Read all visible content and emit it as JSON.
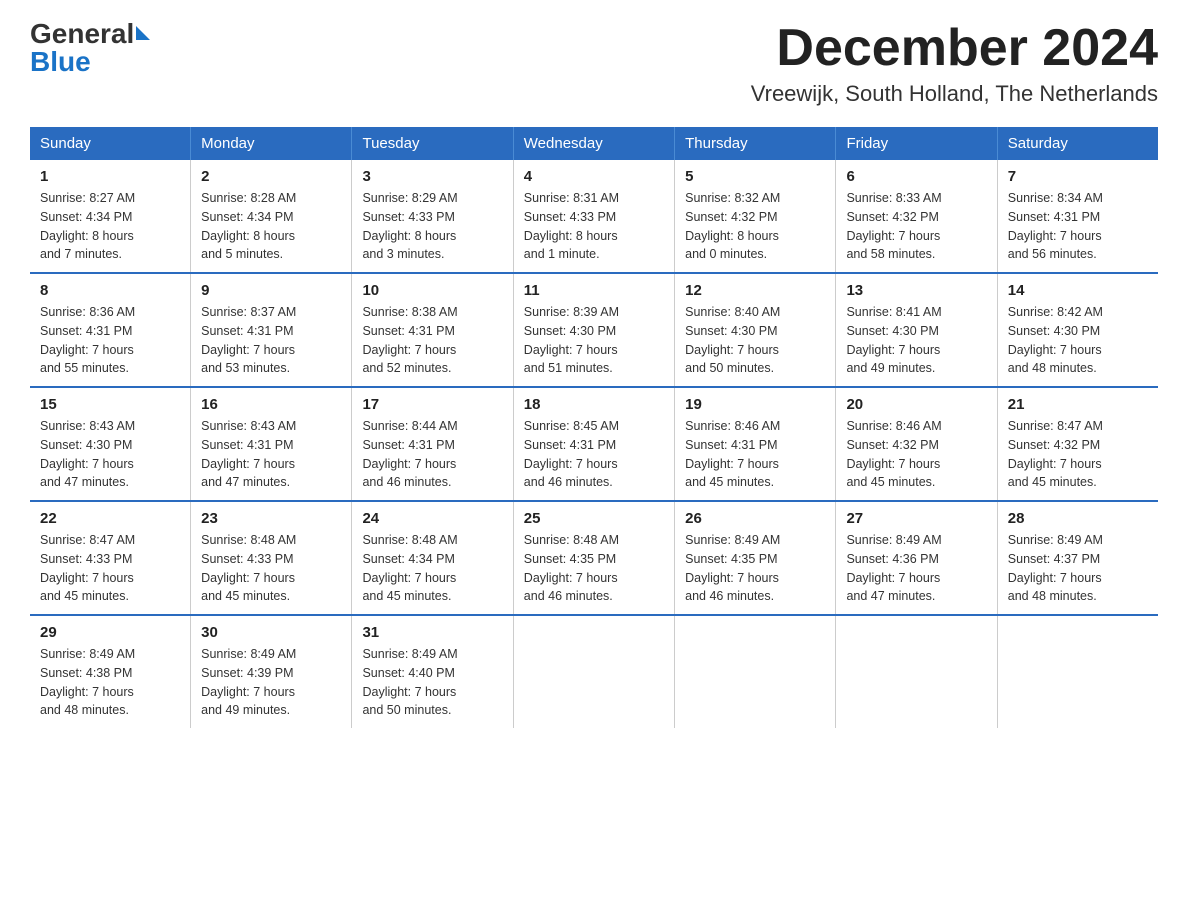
{
  "logo": {
    "text_general": "General",
    "text_blue": "Blue"
  },
  "title": "December 2024",
  "subtitle": "Vreewijk, South Holland, The Netherlands",
  "weekdays": [
    "Sunday",
    "Monday",
    "Tuesday",
    "Wednesday",
    "Thursday",
    "Friday",
    "Saturday"
  ],
  "weeks": [
    [
      {
        "day": "1",
        "info": "Sunrise: 8:27 AM\nSunset: 4:34 PM\nDaylight: 8 hours\nand 7 minutes."
      },
      {
        "day": "2",
        "info": "Sunrise: 8:28 AM\nSunset: 4:34 PM\nDaylight: 8 hours\nand 5 minutes."
      },
      {
        "day": "3",
        "info": "Sunrise: 8:29 AM\nSunset: 4:33 PM\nDaylight: 8 hours\nand 3 minutes."
      },
      {
        "day": "4",
        "info": "Sunrise: 8:31 AM\nSunset: 4:33 PM\nDaylight: 8 hours\nand 1 minute."
      },
      {
        "day": "5",
        "info": "Sunrise: 8:32 AM\nSunset: 4:32 PM\nDaylight: 8 hours\nand 0 minutes."
      },
      {
        "day": "6",
        "info": "Sunrise: 8:33 AM\nSunset: 4:32 PM\nDaylight: 7 hours\nand 58 minutes."
      },
      {
        "day": "7",
        "info": "Sunrise: 8:34 AM\nSunset: 4:31 PM\nDaylight: 7 hours\nand 56 minutes."
      }
    ],
    [
      {
        "day": "8",
        "info": "Sunrise: 8:36 AM\nSunset: 4:31 PM\nDaylight: 7 hours\nand 55 minutes."
      },
      {
        "day": "9",
        "info": "Sunrise: 8:37 AM\nSunset: 4:31 PM\nDaylight: 7 hours\nand 53 minutes."
      },
      {
        "day": "10",
        "info": "Sunrise: 8:38 AM\nSunset: 4:31 PM\nDaylight: 7 hours\nand 52 minutes."
      },
      {
        "day": "11",
        "info": "Sunrise: 8:39 AM\nSunset: 4:30 PM\nDaylight: 7 hours\nand 51 minutes."
      },
      {
        "day": "12",
        "info": "Sunrise: 8:40 AM\nSunset: 4:30 PM\nDaylight: 7 hours\nand 50 minutes."
      },
      {
        "day": "13",
        "info": "Sunrise: 8:41 AM\nSunset: 4:30 PM\nDaylight: 7 hours\nand 49 minutes."
      },
      {
        "day": "14",
        "info": "Sunrise: 8:42 AM\nSunset: 4:30 PM\nDaylight: 7 hours\nand 48 minutes."
      }
    ],
    [
      {
        "day": "15",
        "info": "Sunrise: 8:43 AM\nSunset: 4:30 PM\nDaylight: 7 hours\nand 47 minutes."
      },
      {
        "day": "16",
        "info": "Sunrise: 8:43 AM\nSunset: 4:31 PM\nDaylight: 7 hours\nand 47 minutes."
      },
      {
        "day": "17",
        "info": "Sunrise: 8:44 AM\nSunset: 4:31 PM\nDaylight: 7 hours\nand 46 minutes."
      },
      {
        "day": "18",
        "info": "Sunrise: 8:45 AM\nSunset: 4:31 PM\nDaylight: 7 hours\nand 46 minutes."
      },
      {
        "day": "19",
        "info": "Sunrise: 8:46 AM\nSunset: 4:31 PM\nDaylight: 7 hours\nand 45 minutes."
      },
      {
        "day": "20",
        "info": "Sunrise: 8:46 AM\nSunset: 4:32 PM\nDaylight: 7 hours\nand 45 minutes."
      },
      {
        "day": "21",
        "info": "Sunrise: 8:47 AM\nSunset: 4:32 PM\nDaylight: 7 hours\nand 45 minutes."
      }
    ],
    [
      {
        "day": "22",
        "info": "Sunrise: 8:47 AM\nSunset: 4:33 PM\nDaylight: 7 hours\nand 45 minutes."
      },
      {
        "day": "23",
        "info": "Sunrise: 8:48 AM\nSunset: 4:33 PM\nDaylight: 7 hours\nand 45 minutes."
      },
      {
        "day": "24",
        "info": "Sunrise: 8:48 AM\nSunset: 4:34 PM\nDaylight: 7 hours\nand 45 minutes."
      },
      {
        "day": "25",
        "info": "Sunrise: 8:48 AM\nSunset: 4:35 PM\nDaylight: 7 hours\nand 46 minutes."
      },
      {
        "day": "26",
        "info": "Sunrise: 8:49 AM\nSunset: 4:35 PM\nDaylight: 7 hours\nand 46 minutes."
      },
      {
        "day": "27",
        "info": "Sunrise: 8:49 AM\nSunset: 4:36 PM\nDaylight: 7 hours\nand 47 minutes."
      },
      {
        "day": "28",
        "info": "Sunrise: 8:49 AM\nSunset: 4:37 PM\nDaylight: 7 hours\nand 48 minutes."
      }
    ],
    [
      {
        "day": "29",
        "info": "Sunrise: 8:49 AM\nSunset: 4:38 PM\nDaylight: 7 hours\nand 48 minutes."
      },
      {
        "day": "30",
        "info": "Sunrise: 8:49 AM\nSunset: 4:39 PM\nDaylight: 7 hours\nand 49 minutes."
      },
      {
        "day": "31",
        "info": "Sunrise: 8:49 AM\nSunset: 4:40 PM\nDaylight: 7 hours\nand 50 minutes."
      },
      {
        "day": "",
        "info": ""
      },
      {
        "day": "",
        "info": ""
      },
      {
        "day": "",
        "info": ""
      },
      {
        "day": "",
        "info": ""
      }
    ]
  ]
}
